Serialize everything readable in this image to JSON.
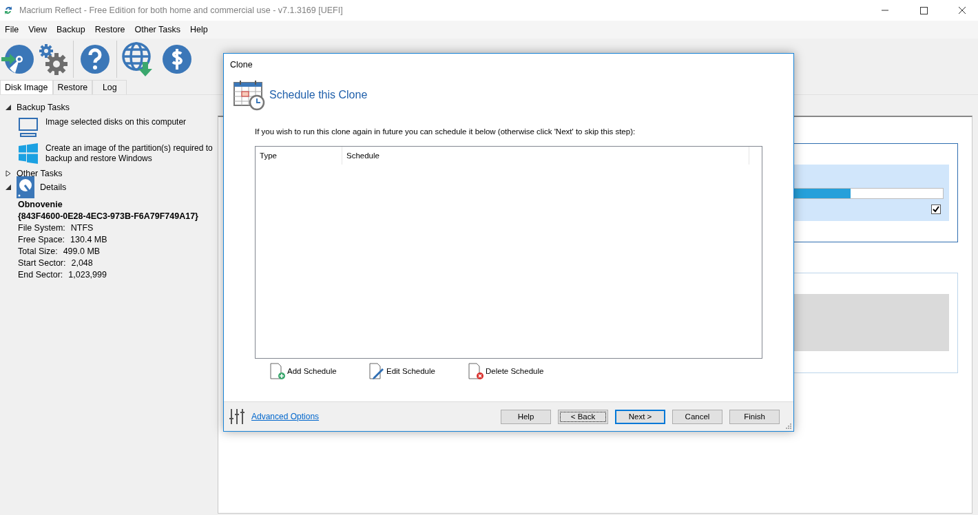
{
  "window": {
    "title": "Macrium Reflect - Free Edition for both home and commercial use - v7.1.3169  [UEFI]"
  },
  "menu": [
    "File",
    "View",
    "Backup",
    "Restore",
    "Other Tasks",
    "Help"
  ],
  "tabs": [
    {
      "label": "Disk Image",
      "selected": true
    },
    {
      "label": "Restore",
      "selected": false
    },
    {
      "label": "Log",
      "selected": false
    }
  ],
  "sidebar": [
    {
      "title": "Backup Tasks",
      "expanded": true,
      "items": [
        {
          "text": "Image selected disks on this computer",
          "kind": "monitor"
        },
        {
          "text": "Create an image of the partition(s) required to backup and restore Windows",
          "kind": "windows"
        }
      ]
    },
    {
      "title": "Other Tasks",
      "expanded": false
    },
    {
      "title": "Details",
      "expanded": true,
      "kind": "disk"
    }
  ],
  "details": {
    "name": "Obnovenie",
    "id": "{843F4600-0E28-4EC3-973B-F6A79F749A17}",
    "fields": [
      {
        "label": "File System:",
        "value": "NTFS"
      },
      {
        "label": "Free Space:",
        "value": "130.4 MB"
      },
      {
        "label": "Total Size:",
        "value": "499.0 MB"
      },
      {
        "label": "Start Sector:",
        "value": "2,048"
      },
      {
        "label": "End Sector:",
        "value": "1,023,999"
      }
    ]
  },
  "disk_panel": {
    "progress": {
      "level": 0.87
    },
    "checked": true
  },
  "dialog": {
    "title": "Clone",
    "heading": "Schedule this Clone",
    "instruction": "If you wish to run this clone again in future you can schedule it below (otherwise click 'Next' to skip this step):",
    "columns": [
      "Type",
      "Schedule"
    ],
    "actions": [
      {
        "label": "Add Schedule",
        "kind": "add"
      },
      {
        "label": "Edit Schedule",
        "kind": "edit"
      },
      {
        "label": "Delete Schedule",
        "kind": "delete"
      }
    ],
    "link": "Advanced Options",
    "buttons": [
      {
        "label": "Help",
        "kind": "normal"
      },
      {
        "label": "< Back",
        "kind": "focused"
      },
      {
        "label": "Next >",
        "kind": "default"
      },
      {
        "label": "Cancel",
        "kind": "normal"
      },
      {
        "label": "Finish",
        "kind": "normal"
      }
    ]
  }
}
